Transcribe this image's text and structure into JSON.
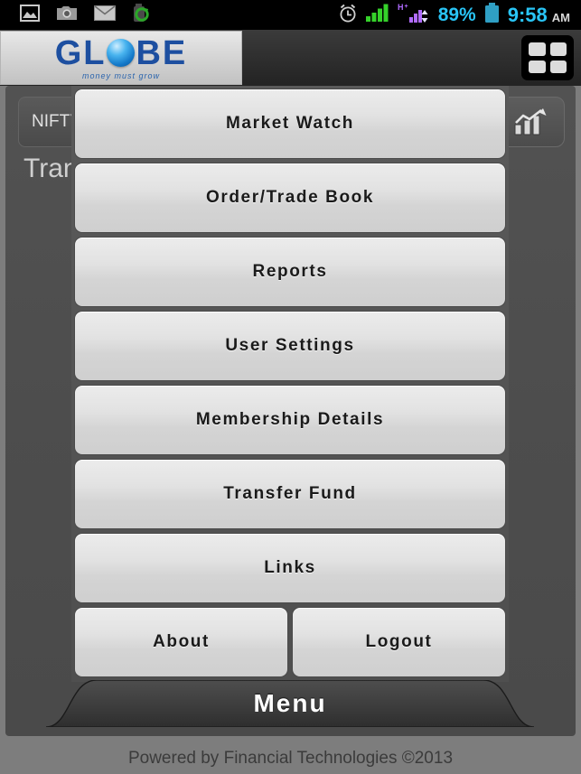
{
  "statusbar": {
    "left_icons": [
      {
        "name": "gallery-icon"
      },
      {
        "name": "camera-icon"
      },
      {
        "name": "email-icon"
      },
      {
        "name": "sync-icon"
      }
    ],
    "alarm_icon": "alarm-clock-icon",
    "signal_icon": "signal-bars-icon",
    "data_icon": "hplus-data-icon",
    "data_label": "H+",
    "battery_percent": "89%",
    "battery_icon": "battery-icon",
    "time": "9:58",
    "ampm": "AM"
  },
  "header": {
    "logo_text_left": "GL",
    "logo_text_right": "BE",
    "logo_tagline": "money must grow",
    "grid_button_name": "apps-grid-button"
  },
  "toolbar": {
    "nifty_label": "NIFTY",
    "chart_button_name": "market-chart-button"
  },
  "page": {
    "title": "Tran"
  },
  "menu": {
    "items": [
      {
        "label": "Market Watch",
        "name": "menu-item-market-watch"
      },
      {
        "label": "Order/Trade Book",
        "name": "menu-item-order-trade-book"
      },
      {
        "label": "Reports",
        "name": "menu-item-reports"
      },
      {
        "label": "User Settings",
        "name": "menu-item-user-settings"
      },
      {
        "label": "Membership Details",
        "name": "menu-item-membership-details"
      },
      {
        "label": "Transfer Fund",
        "name": "menu-item-transfer-fund"
      },
      {
        "label": "Links",
        "name": "menu-item-links"
      }
    ],
    "bottom_row": [
      {
        "label": "About",
        "name": "menu-item-about"
      },
      {
        "label": "Logout",
        "name": "menu-item-logout"
      }
    ],
    "tab_label": "Menu"
  },
  "footer": {
    "text": "Powered by Financial Technologies ©2013"
  },
  "colors": {
    "status_text": "#29c5f6",
    "logo_blue": "#1d4fa0",
    "page_bg": "#4d4d4d",
    "button_face": "#e2e2e2"
  }
}
